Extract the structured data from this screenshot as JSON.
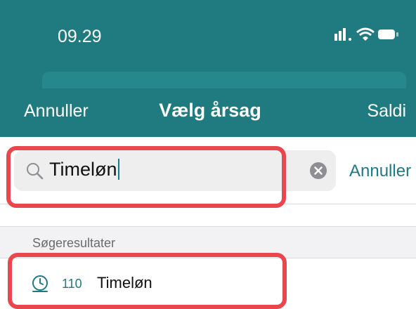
{
  "status_bar": {
    "time": "09.29",
    "icons": [
      "signal-icon",
      "wifi-icon",
      "battery-icon"
    ]
  },
  "nav": {
    "left_label": "Annuller",
    "title": "Vælg årsag",
    "right_label": "Saldi"
  },
  "search": {
    "value": "Timeløn",
    "cancel_label": "Annuller"
  },
  "results": {
    "section_header": "Søgeresultater",
    "items": [
      {
        "code": "110",
        "label": "Timeløn",
        "icon": "clock-icon"
      }
    ]
  },
  "colors": {
    "header": "#1f7b80",
    "accent": "#1f7b80",
    "highlight": "#e8474d"
  }
}
